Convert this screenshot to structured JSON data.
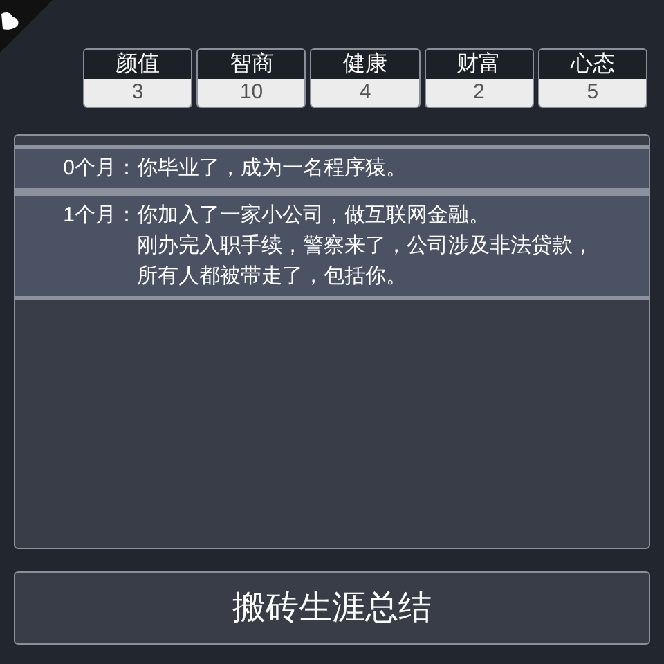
{
  "stats": [
    {
      "label": "颜值",
      "value": "3"
    },
    {
      "label": "智商",
      "value": "10"
    },
    {
      "label": "健康",
      "value": "4"
    },
    {
      "label": "财富",
      "value": "2"
    },
    {
      "label": "心态",
      "value": "5"
    }
  ],
  "log": [
    {
      "age": "0个月：",
      "lines": [
        "你毕业了，成为一名程序猿。"
      ]
    },
    {
      "age": "1个月：",
      "lines": [
        "你加入了一家小公司，做互联网金融。",
        "刚办完入职手续，警察来了，公司涉及非法贷款，",
        "所有人都被带走了，包括你。"
      ]
    }
  ],
  "summary_button": "搬砖生涯总结"
}
